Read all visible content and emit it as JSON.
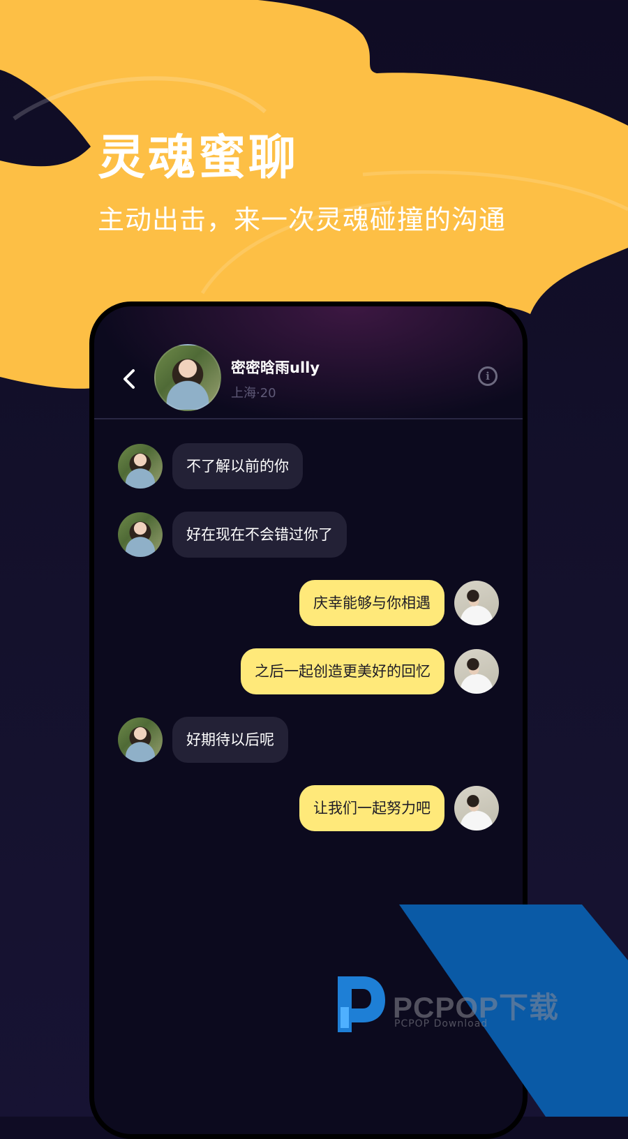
{
  "hero": {
    "title": "灵魂蜜聊",
    "subtitle": "主动出击，来一次灵魂碰撞的沟通"
  },
  "header": {
    "back_icon": "chevron-left-icon",
    "contact_name": "密密晗雨ully",
    "contact_meta": "上海·20",
    "info_icon": "info-icon",
    "info_glyph": "i"
  },
  "messages": [
    {
      "side": "left",
      "text": "不了解以前的你"
    },
    {
      "side": "left",
      "text": "好在现在不会错过你了"
    },
    {
      "side": "right",
      "text": "庆幸能够与你相遇"
    },
    {
      "side": "right",
      "text": "之后一起创造更美好的回忆"
    },
    {
      "side": "left",
      "text": "好期待以后呢"
    },
    {
      "side": "right",
      "text": "让我们一起努力吧"
    }
  ],
  "watermark": {
    "title": "PCPOP下载",
    "subtitle": "PCPOP Download"
  },
  "colors": {
    "accent_yellow": "#fdbf45",
    "sent_bubble": "#ffe97a",
    "received_bubble": "#232136",
    "background": "#0f0c24",
    "watermark_blue": "#0a5aa6"
  }
}
